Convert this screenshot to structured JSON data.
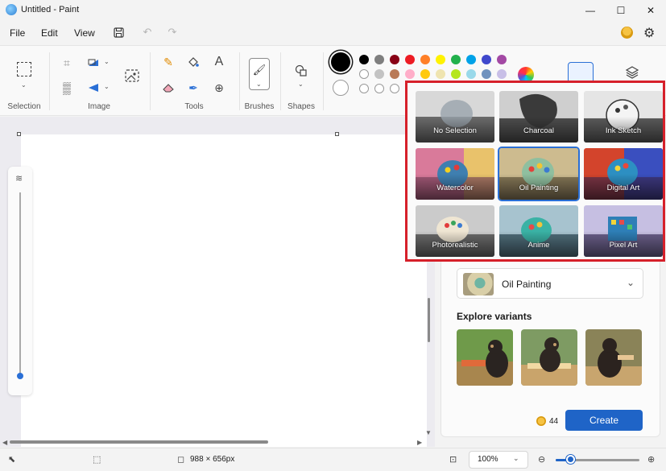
{
  "window": {
    "title": "Untitled - Paint",
    "minimize_glyph": "—",
    "maximize_glyph": "☐",
    "close_glyph": "✕"
  },
  "menu": {
    "file": "File",
    "edit": "Edit",
    "view": "View"
  },
  "ribbon": {
    "groups": {
      "selection": "Selection",
      "image": "Image",
      "tools": "Tools",
      "brushes": "Brushes",
      "shapes": "Shapes"
    },
    "palette_row1": [
      "#000000",
      "#7f7f7f",
      "#880015",
      "#ed1c24",
      "#ff7f27",
      "#fff200",
      "#22b14c",
      "#00a2e8",
      "#3f48cc",
      "#a349a4"
    ],
    "palette_row2": [
      "",
      "#c3c3c3",
      "#b97a57",
      "#ffaec9",
      "#ffc90e",
      "#efe4b0",
      "#b5e61d",
      "#99d9ea",
      "#7092be",
      "#c8bfe7"
    ],
    "palette_row3": [
      "",
      "",
      "",
      "",
      "",
      "",
      "",
      "",
      "",
      ""
    ]
  },
  "style_popup": {
    "tiles": [
      {
        "label": "No Selection",
        "selected": false
      },
      {
        "label": "Charcoal",
        "selected": false
      },
      {
        "label": "Ink Sketch",
        "selected": false
      },
      {
        "label": "Watercolor",
        "selected": false
      },
      {
        "label": "Oil Painting",
        "selected": true
      },
      {
        "label": "Digital Art",
        "selected": false
      },
      {
        "label": "Photorealistic",
        "selected": false
      },
      {
        "label": "Anime",
        "selected": false
      },
      {
        "label": "Pixel Art",
        "selected": false
      }
    ]
  },
  "side_panel": {
    "selected_style": "Oil Painting",
    "explore_label": "Explore variants",
    "credits": "44",
    "create_label": "Create"
  },
  "status": {
    "dimensions": "988 × 656px",
    "zoom": "100%"
  }
}
